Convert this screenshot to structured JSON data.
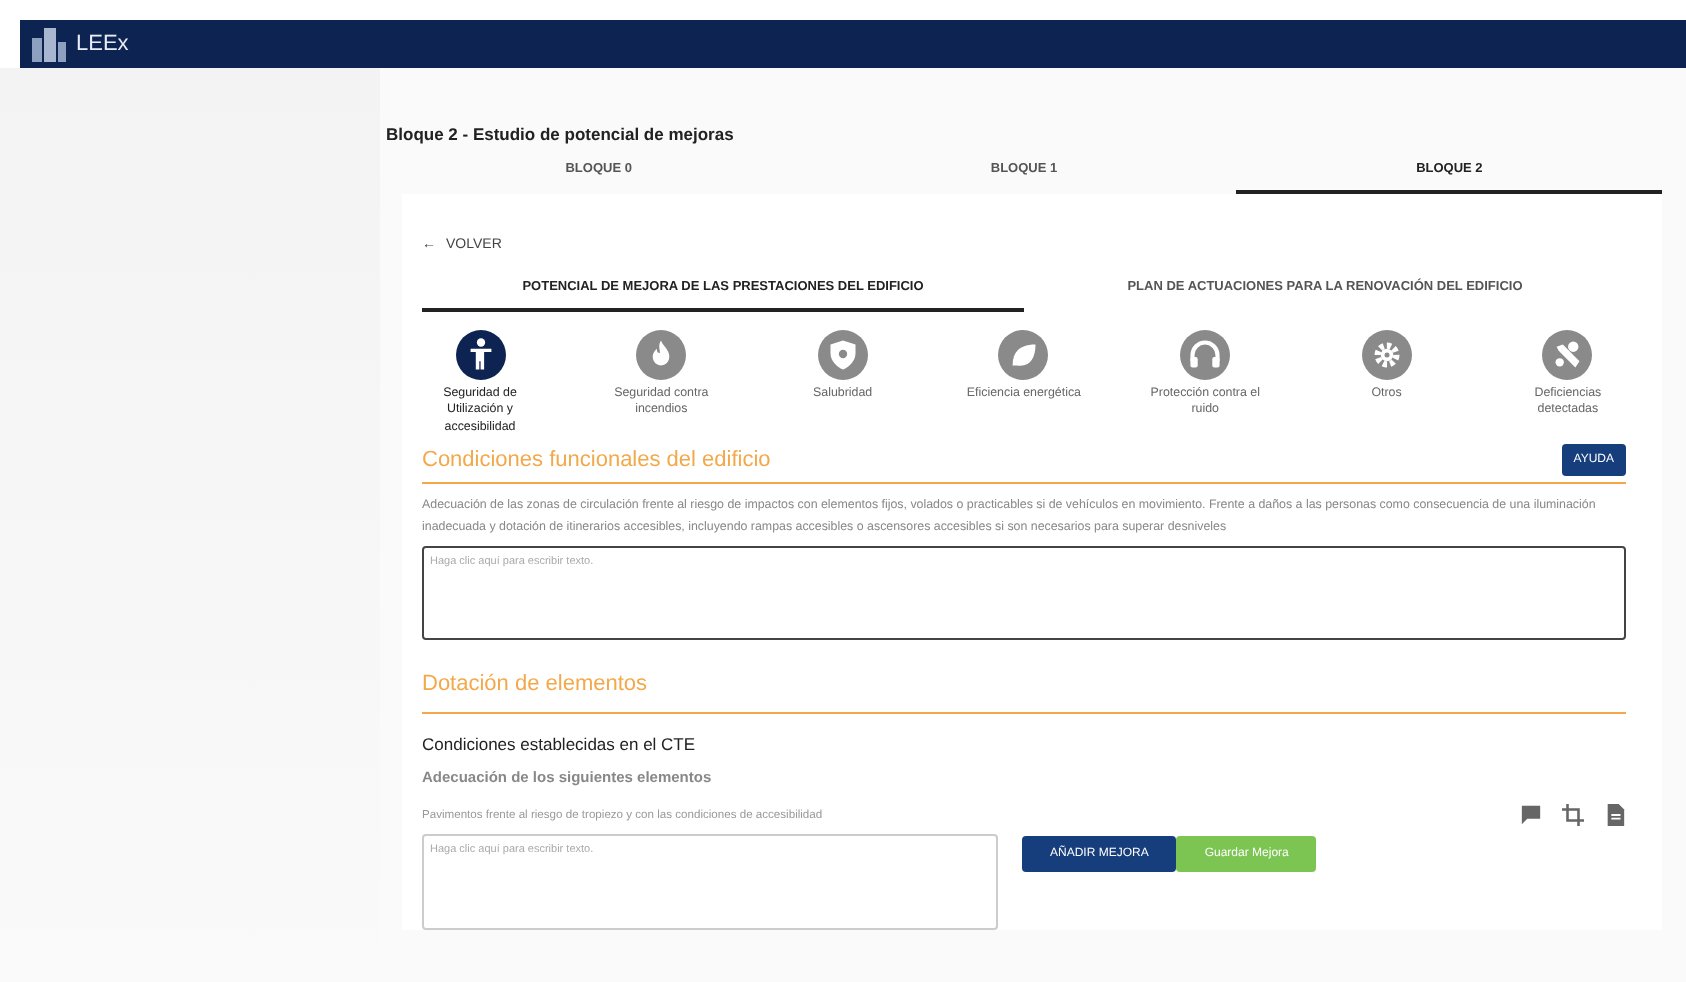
{
  "app": {
    "title": "LEEx"
  },
  "page_title": "Bloque 2 - Estudio de potencial de mejoras",
  "block_tabs": [
    {
      "label": "BLOQUE 0",
      "selected": false
    },
    {
      "label": "BLOQUE 1",
      "selected": false
    },
    {
      "label": "BLOQUE 2",
      "selected": true
    }
  ],
  "back_link": {
    "icon": "←",
    "label": "VOLVER"
  },
  "sub_tabs": [
    {
      "label": "POTENCIAL DE MEJORA DE LAS PRESTACIONES DEL EDIFICIO",
      "selected": true
    },
    {
      "label": "PLAN DE ACTUACIONES PARA LA RENOVACIÓN DEL EDIFICIO",
      "selected": false
    }
  ],
  "categories": [
    {
      "label": "Seguridad de Utilización y accesibilidad",
      "kind": "person",
      "selected": true
    },
    {
      "label": "Seguridad contra incendios",
      "kind": "fire",
      "selected": false
    },
    {
      "label": "Salubridad",
      "kind": "shield",
      "selected": false
    },
    {
      "label": "Eficiencia energética",
      "kind": "leaf",
      "selected": false
    },
    {
      "label": "Protección contra el ruido",
      "kind": "headphones",
      "selected": false
    },
    {
      "label": "Otros",
      "kind": "gear",
      "selected": false
    },
    {
      "label": "Deficiencias detectadas",
      "kind": "tools",
      "selected": false
    }
  ],
  "section1": {
    "heading": "Condiciones funcionales del edificio",
    "help_button": "AYUDA",
    "description": "Adecuación de las zonas de circulación frente al riesgo de impactos con elementos fijos, volados o practicables si de vehículos en movimiento. Frente a daños a las personas como consecuencia de una iluminación inadecuada y dotación de itinerarios accesibles, incluyendo rampas accesibles o ascensores accesibles si son necesarios para superar desniveles",
    "placeholder": "Haga clic aquí para escribir texto."
  },
  "section2": {
    "heading": "Dotación de elementos",
    "subheading": "Condiciones establecidas en el CTE",
    "label": "Adecuación de los siguientes elementos",
    "item": "Pavimentos frente al riesgo de tropiezo y con las condiciones de accesibilidad",
    "placeholder": "Haga clic aquí para escribir texto.",
    "buttons": [
      {
        "label": "AÑADIR MEJORA",
        "kind": "primary"
      },
      {
        "label": "Guardar Mejora",
        "kind": "success"
      }
    ]
  }
}
